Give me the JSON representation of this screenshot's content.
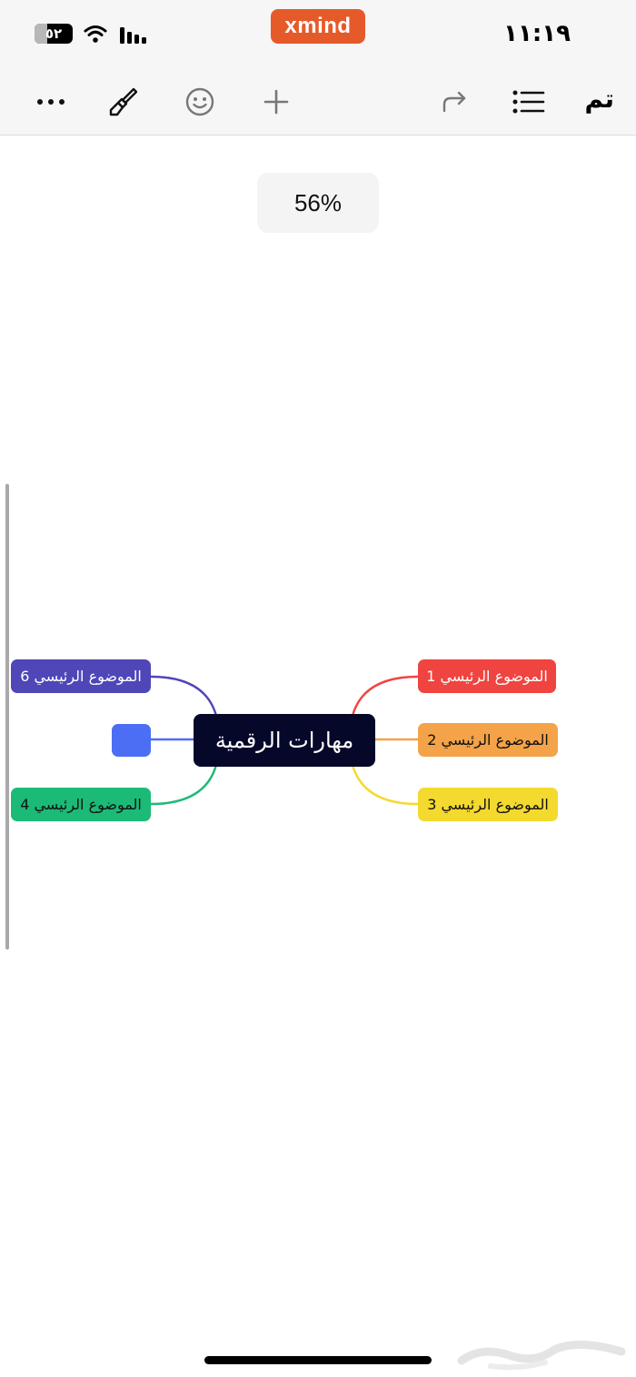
{
  "status_bar": {
    "battery": "٥٢",
    "brand": "xmind",
    "time": "١١:١٩"
  },
  "toolbar": {
    "more": "more-icon",
    "style": "paintbrush-icon",
    "sticker": "smiley-icon",
    "add": "plus-icon",
    "redo": "redo-icon",
    "outline": "list-icon",
    "done_label": "تم"
  },
  "zoom": {
    "level": "56%"
  },
  "mindmap": {
    "central_topic": "مهارات الرقمية",
    "topics": {
      "t1": "الموضوع الرئيسي 1",
      "t2": "الموضوع الرئيسي 2",
      "t3": "الموضوع الرئيسي 3",
      "t4": "الموضوع الرئيسي 4",
      "t5": "",
      "t6": "الموضوع الرئيسي 6"
    },
    "colors": {
      "central": "#06082a",
      "t1": "#f04440",
      "t2": "#f4a348",
      "t3": "#f4d92e",
      "t4": "#1cba77",
      "t5": "#4c6ef5",
      "t6": "#4f46b7"
    }
  }
}
